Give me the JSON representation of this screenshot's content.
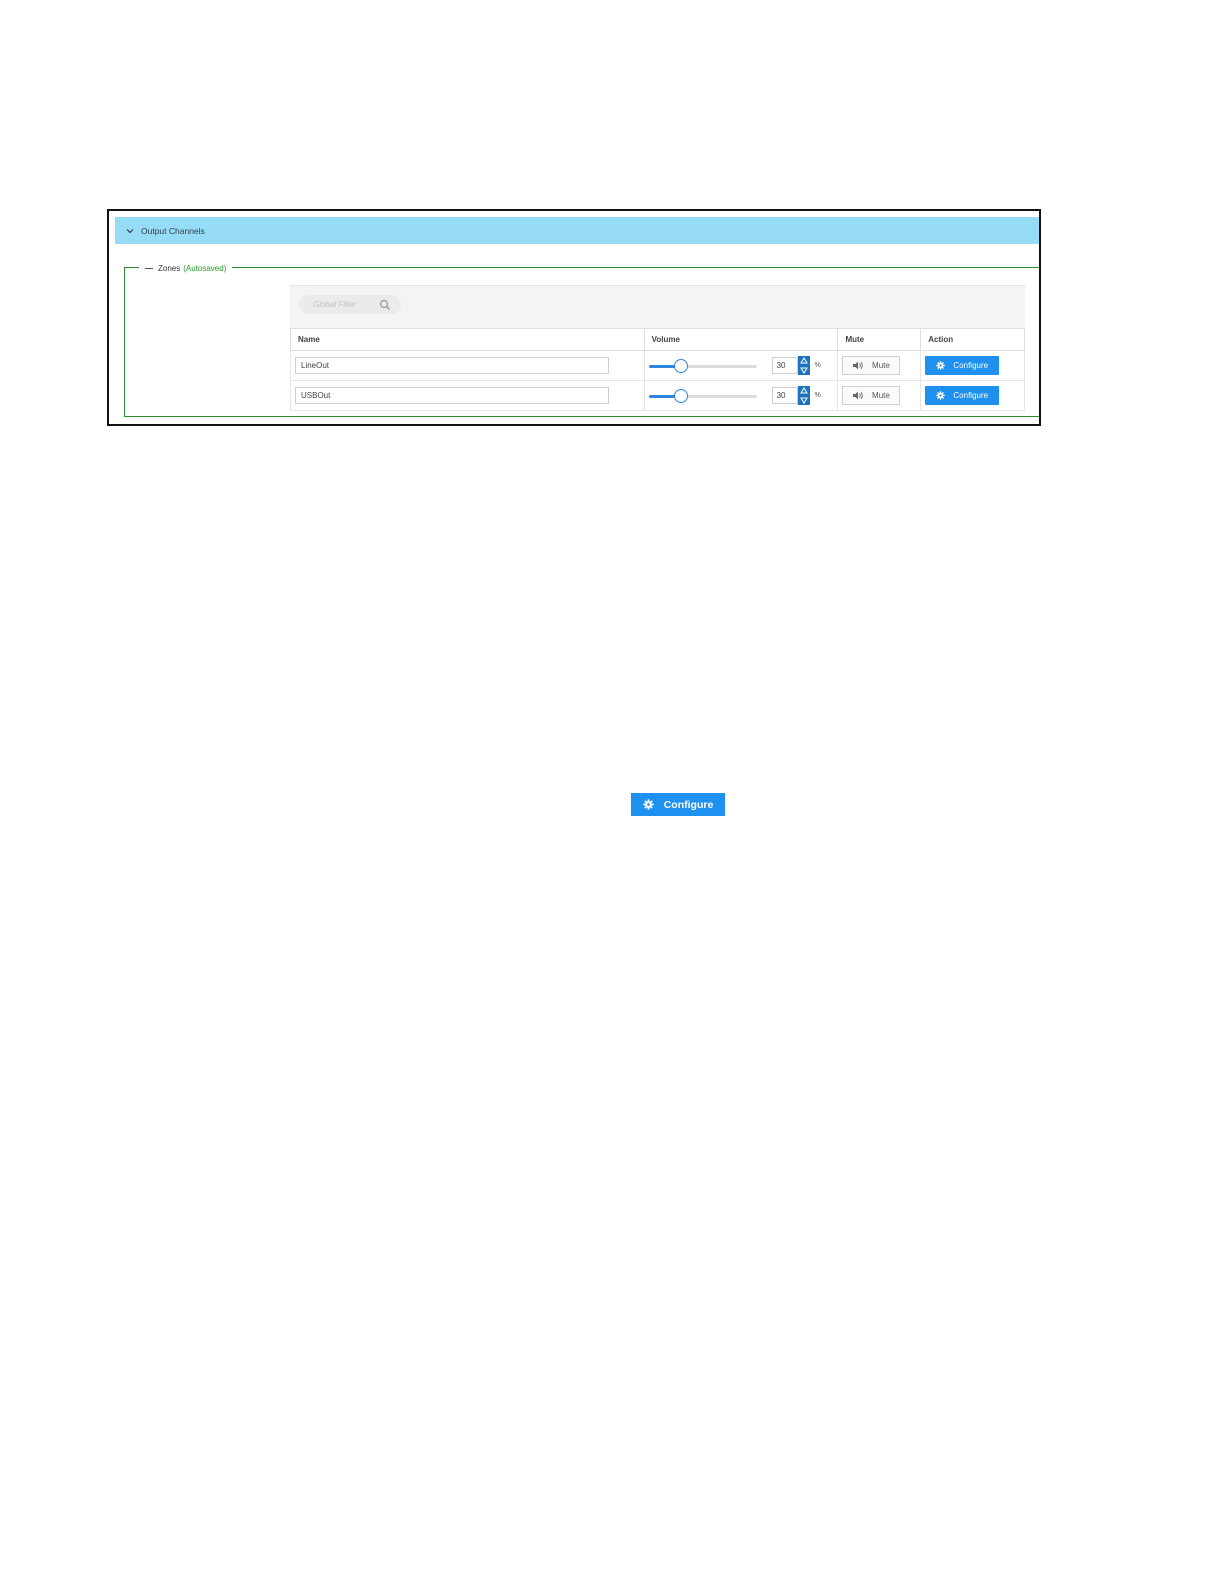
{
  "section": {
    "title": "Output Channels"
  },
  "zones": {
    "legend": "Zones",
    "autosaved": "(Autosaved)",
    "filter_placeholder": "Global Filter",
    "columns": {
      "name": "Name",
      "volume": "Volume",
      "mute": "Mute",
      "action": "Action"
    },
    "rows": [
      {
        "name": "LineOut",
        "volume": 30,
        "volume_unit": "%",
        "mute_label": "Mute",
        "action_label": "Configure"
      },
      {
        "name": "USBOut",
        "volume": 30,
        "volume_unit": "%",
        "mute_label": "Mute",
        "action_label": "Configure"
      }
    ]
  },
  "standalone_button": {
    "label": "Configure"
  },
  "colors": {
    "header_bg": "#97dcf7",
    "accent_blue": "#1e90ef",
    "zones_border": "#2e8b2e",
    "autosaved_green": "#2a9a2a"
  },
  "icons": {
    "collapse": "chevron-down-icon",
    "search": "search-icon",
    "mute": "speaker-icon",
    "configure": "gear-icon"
  }
}
